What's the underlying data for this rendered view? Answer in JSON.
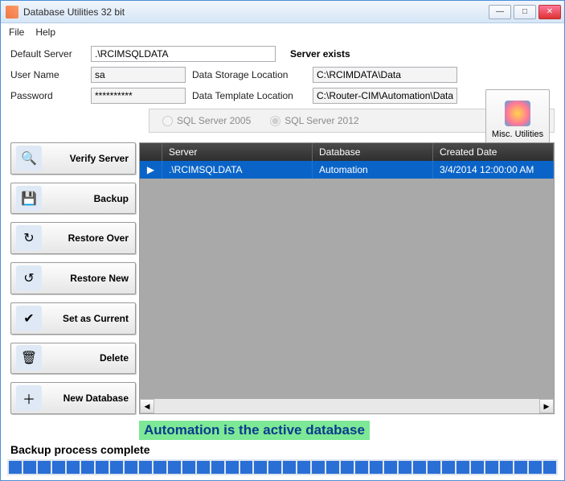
{
  "title": "Database Utilities 32 bit",
  "menu": {
    "file": "File",
    "help": "Help"
  },
  "labels": {
    "default_server": "Default Server",
    "user_name": "User Name",
    "password": "Password",
    "data_storage": "Data Storage Location",
    "data_template": "Data Template Location",
    "server_exists": "Server exists",
    "misc": "Misc. Utilities"
  },
  "fields": {
    "default_server": ".\\RCIMSQLDATA",
    "user_name": "sa",
    "password": "**********",
    "data_storage": "C:\\RCIMDATA\\Data",
    "data_template": "C:\\Router-CIM\\Automation\\Database\\Ba"
  },
  "radios": {
    "sql2005": "SQL Server 2005",
    "sql2012": "SQL Server 2012",
    "selected": "sql2012"
  },
  "side_buttons": {
    "verify": "Verify Server",
    "backup": "Backup",
    "restore_over": "Restore Over",
    "restore_new": "Restore New",
    "set_current": "Set as Current",
    "delete": "Delete",
    "new_db": "New Database"
  },
  "grid": {
    "headers": {
      "server": "Server",
      "database": "Database",
      "created": "Created Date"
    },
    "rows": [
      {
        "server": ".\\RCIMSQLDATA",
        "database": "Automation",
        "created": "3/4/2014 12:00:00 AM"
      }
    ]
  },
  "active_db_msg": "Automation is the active database",
  "status": "Backup process complete",
  "progress_segments": 38
}
